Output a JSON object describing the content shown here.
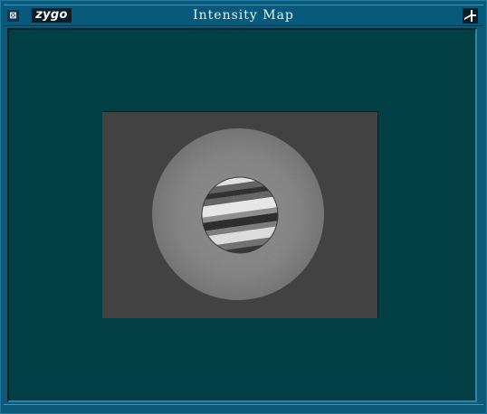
{
  "window": {
    "title": "Intensity Map",
    "logo_text": "zygo",
    "close_glyph": "⊠",
    "close_icon": "close-box-icon",
    "pin_icon": "pin-icon",
    "colors": {
      "frame": "#0d5a78",
      "titlebar": "#085a7c",
      "content_bg": "#023f44",
      "image_bg": "#424242"
    }
  },
  "intensity_map": {
    "content": "interferogram intensity image"
  }
}
